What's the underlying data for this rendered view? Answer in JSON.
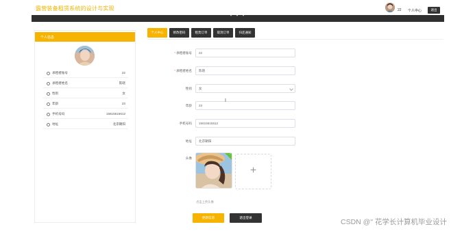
{
  "header": {
    "site_title": "露营装备租赁系统的设计与实现",
    "user_name": "22",
    "user_center": "个人中心",
    "logout": "退出"
  },
  "profile_card": {
    "title": "个人信息",
    "rows": [
      {
        "label": "承租者账号",
        "value": "22"
      },
      {
        "label": "承租者姓名",
        "value": "陈晓"
      },
      {
        "label": "性别",
        "value": "女"
      },
      {
        "label": "年龄",
        "value": "23"
      },
      {
        "label": "手机号码",
        "value": "15615615612"
      },
      {
        "label": "地址",
        "value": "北京朝阳"
      }
    ]
  },
  "tabs": [
    "个人中心",
    "修改密码",
    "租赁订单",
    "取消订单",
    "归还通知"
  ],
  "form": {
    "account_label": "承租者账号",
    "account_value": "22",
    "name_label": "承租者姓名",
    "name_value": "陈晓",
    "gender_label": "性别",
    "gender_value": "女",
    "age_label": "年龄",
    "age_value": "23",
    "phone_label": "手机号码",
    "phone_value": "15615615612",
    "address_label": "地址",
    "address_value": "北京朝阳",
    "avatar_label": "头像",
    "upload_tip": "点击上传头像",
    "add_icon": "plus-icon",
    "success_icon": "check-icon"
  },
  "buttons": {
    "save": "更新信息",
    "logout": "退出登录"
  },
  "watermark": "CSDN @\" 花学长计算机毕业设计",
  "colors": {
    "accent": "#f6b400",
    "dark": "#333333",
    "title": "#f2b300"
  }
}
